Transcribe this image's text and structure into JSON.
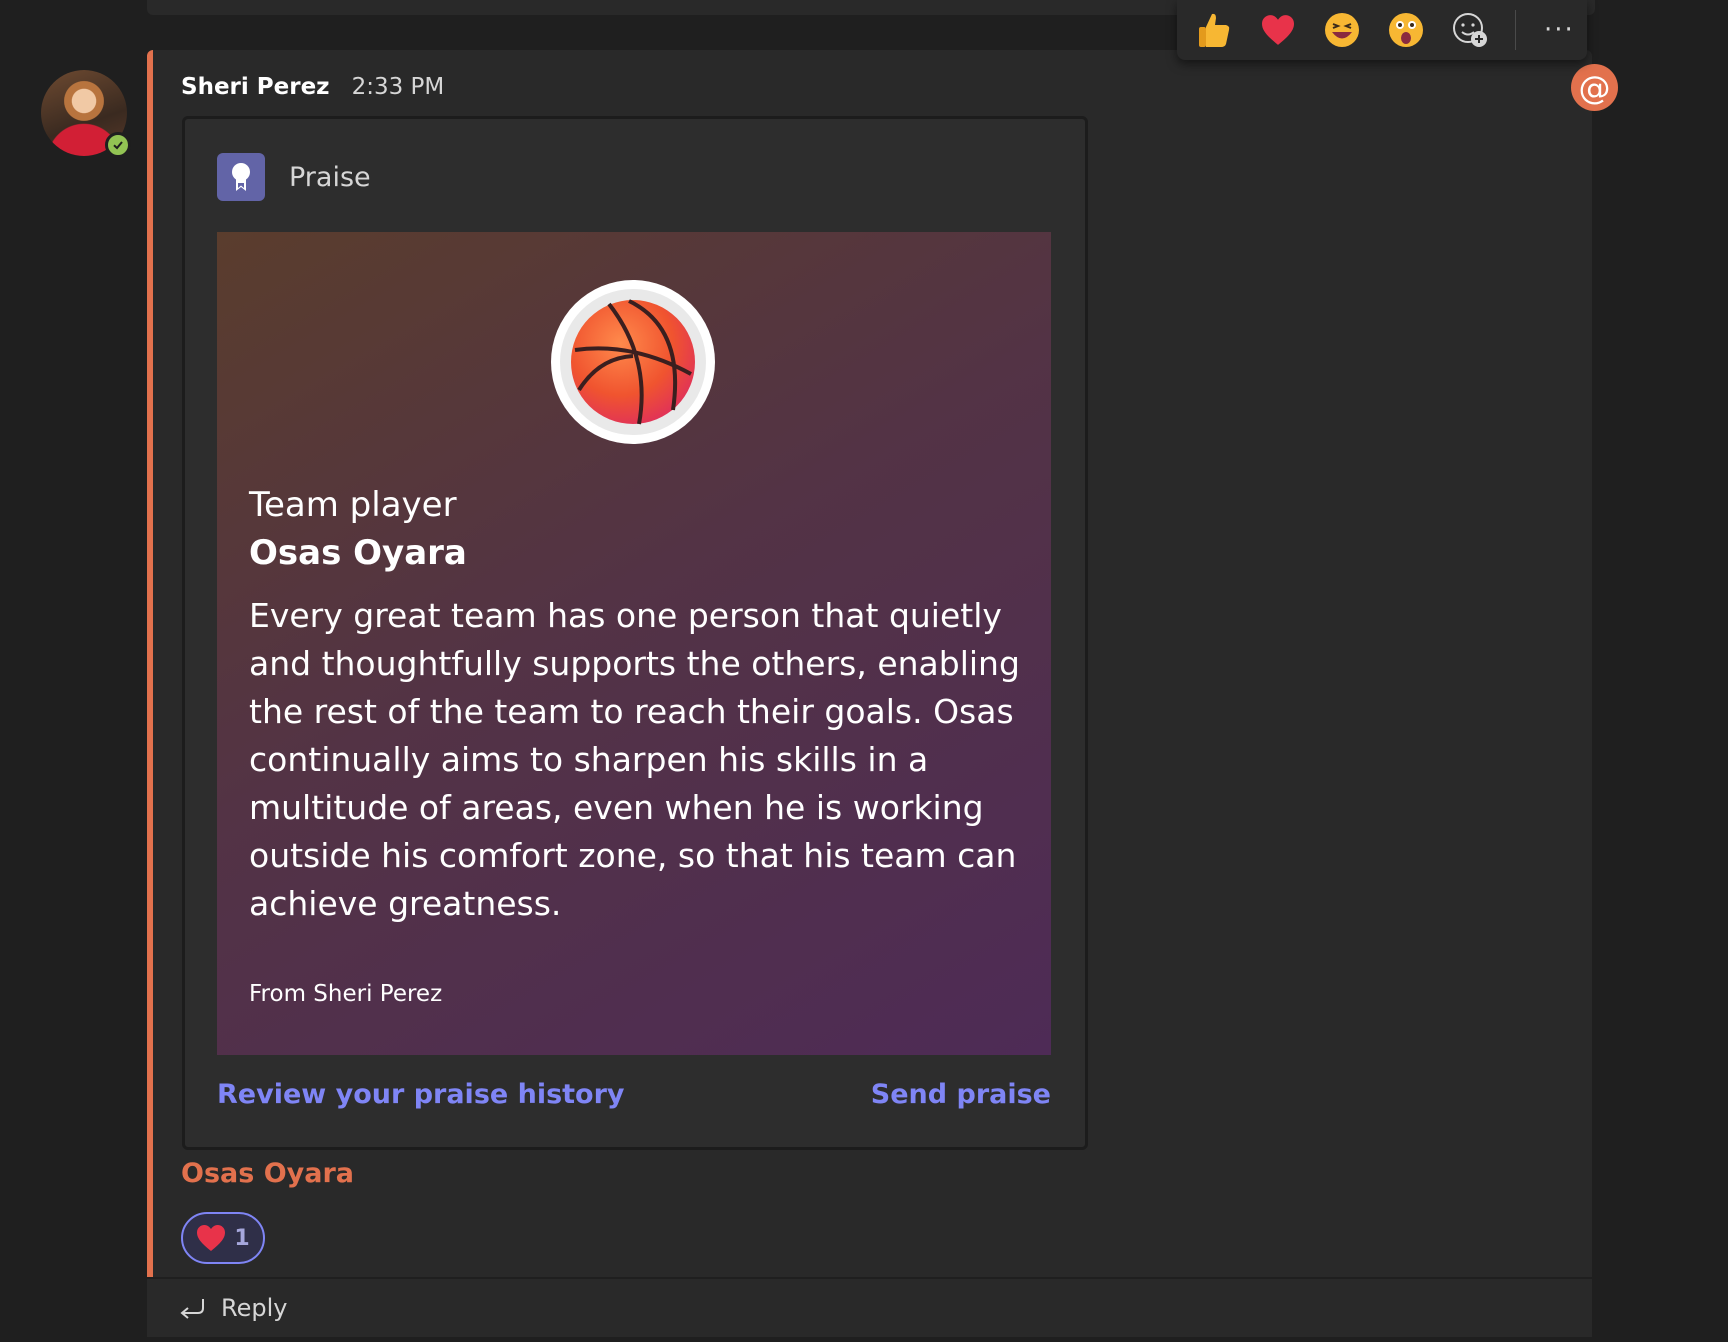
{
  "message": {
    "sender": "Sheri Perez",
    "time": "2:33 PM"
  },
  "mention_badge": "@",
  "card": {
    "app_name": "Praise",
    "badge_icon": "basketball-icon",
    "title": "Team player",
    "recipient": "Osas Oyara",
    "body": "Every great team has one person that quietly and thoughtfully supports the others, enabling the rest of the team to reach their goals. Osas continually aims to sharpen his skills in a multitude of areas, even when he is working outside his comfort zone, so that his team can achieve greatness.",
    "from": "From Sheri Perez",
    "actions": {
      "history": "Review your praise history",
      "send": "Send praise"
    }
  },
  "mention": "Osas Oyara",
  "reaction": {
    "icon": "heart-icon",
    "count": "1"
  },
  "reply_label": "Reply",
  "reactions_bar": {
    "items": [
      "like-icon",
      "heart-icon",
      "laugh-icon",
      "surprised-icon",
      "add-reaction-icon"
    ],
    "more": "···"
  },
  "colors": {
    "accent": "#e2714d",
    "link": "#7f85f5",
    "app_icon": "#6264a7"
  }
}
